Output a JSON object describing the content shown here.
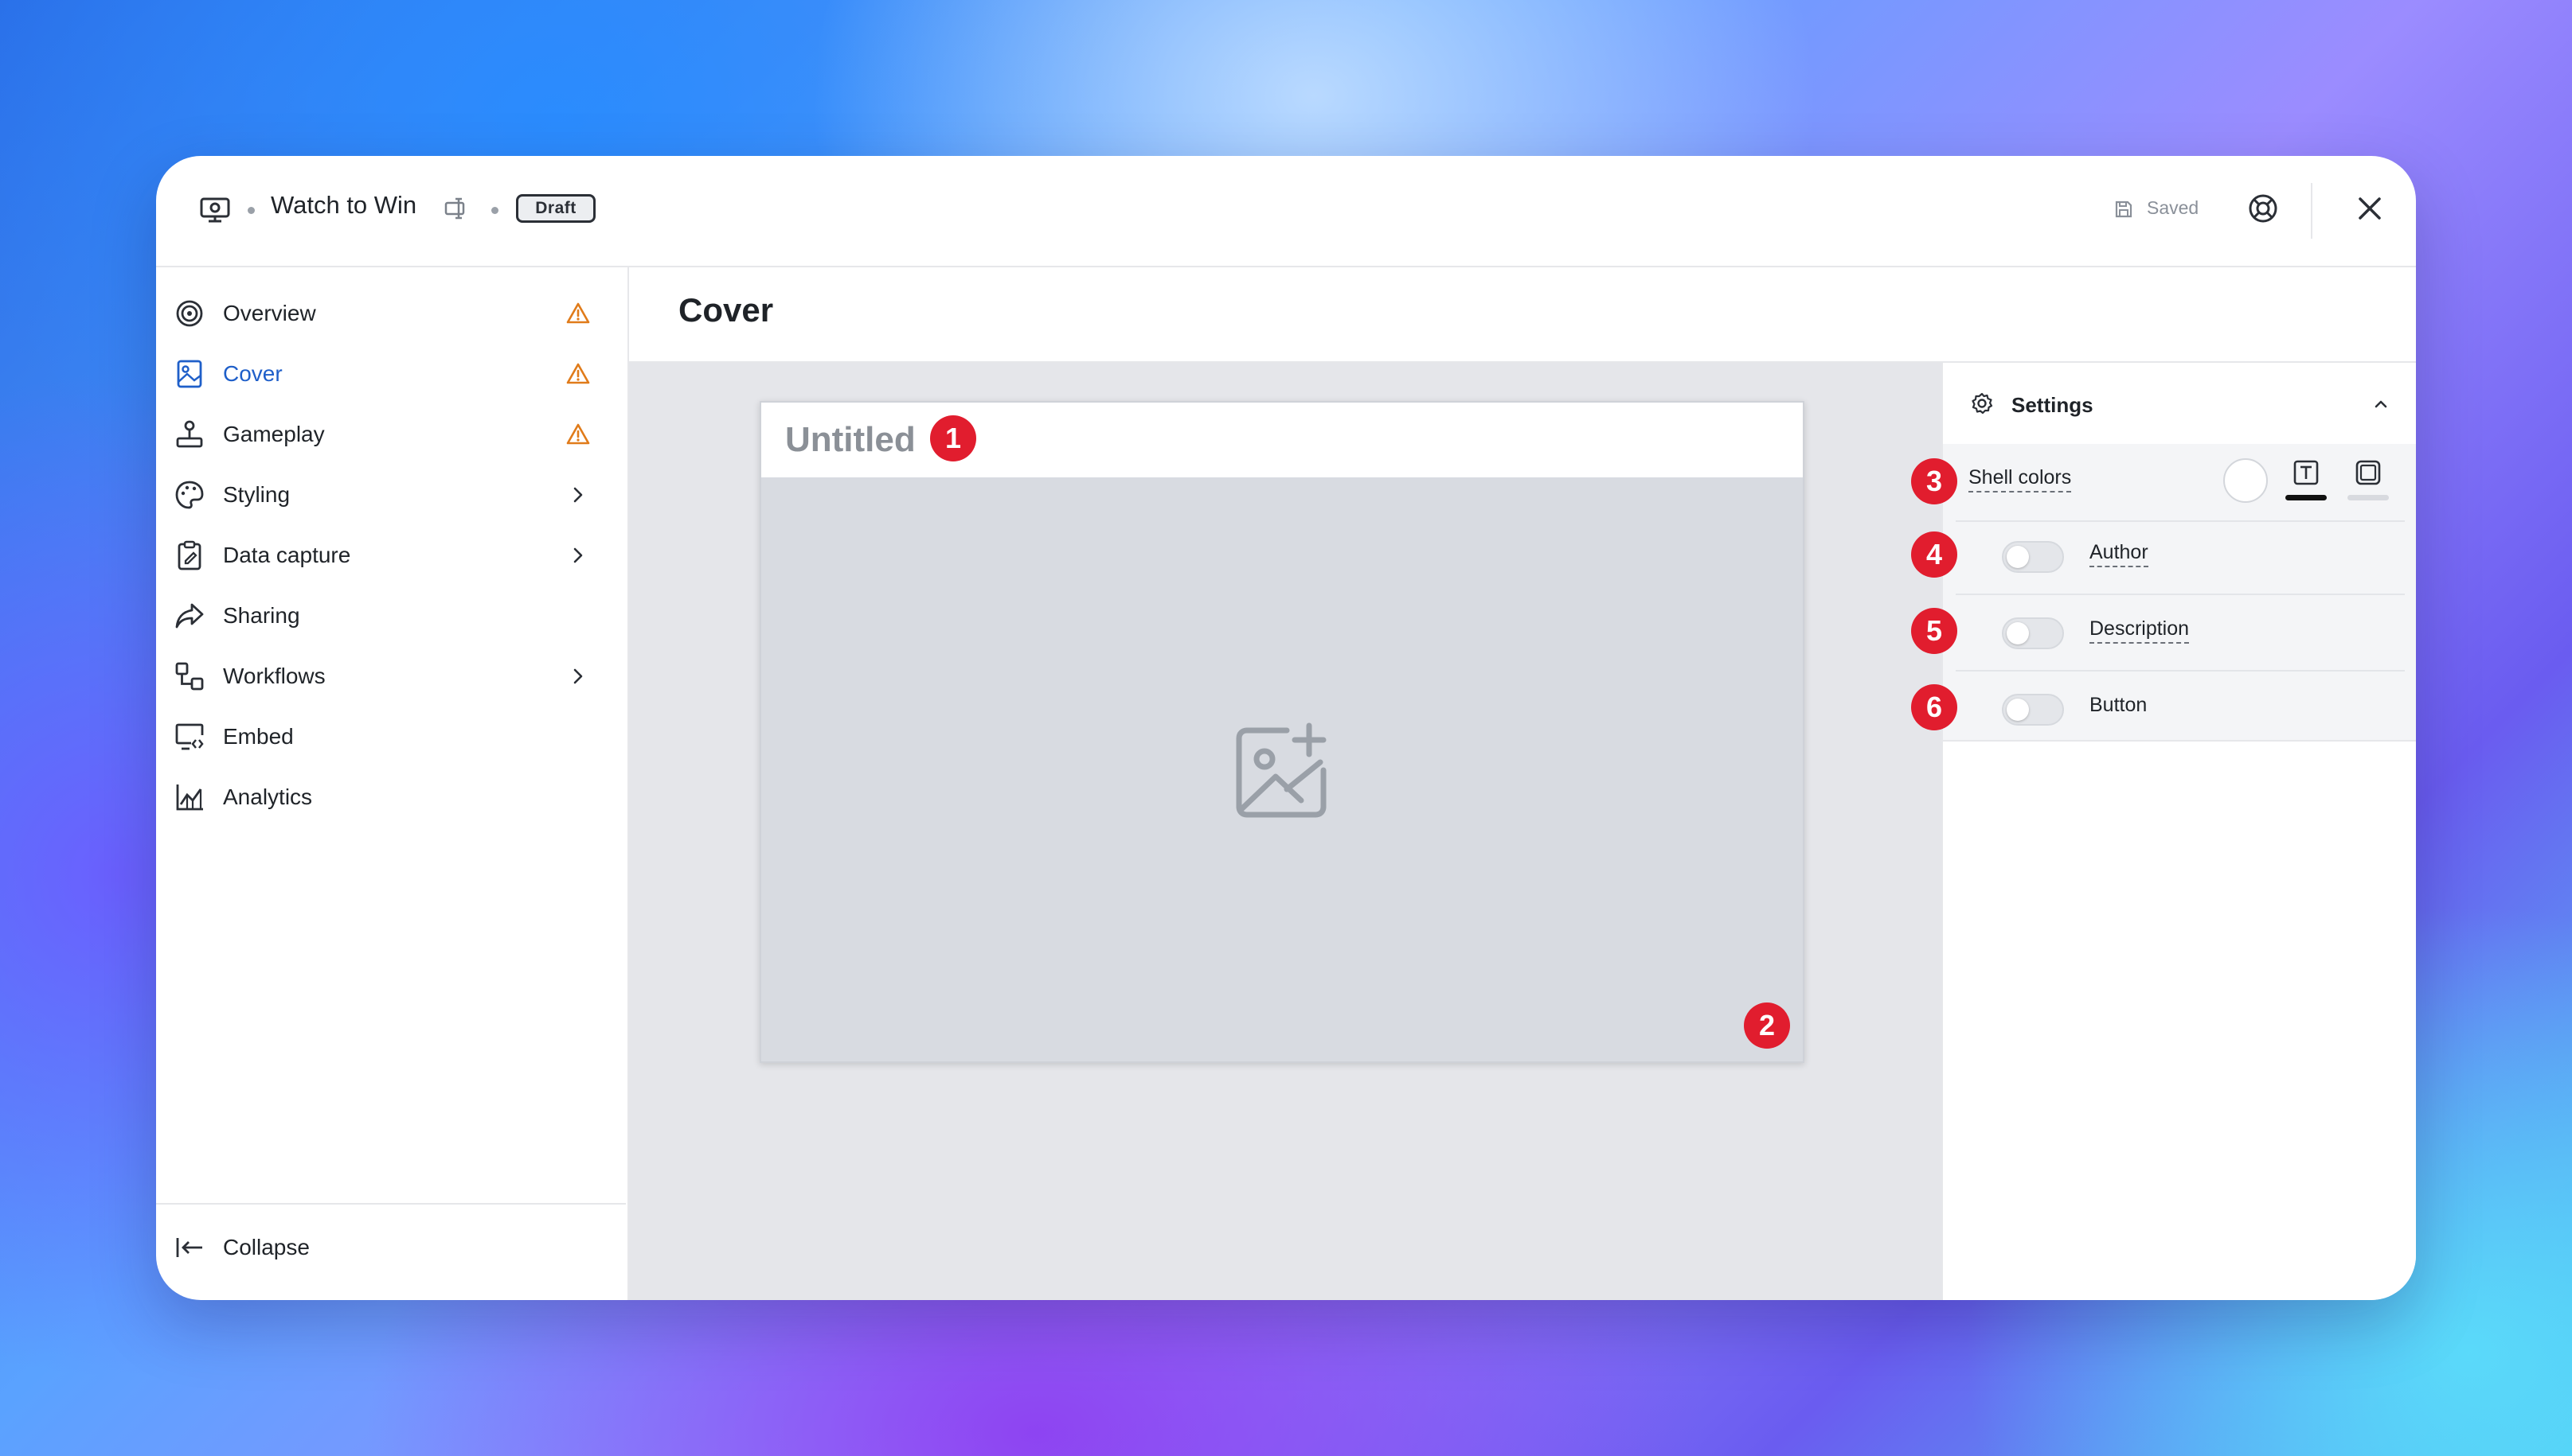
{
  "header": {
    "title": "Watch to Win",
    "status_badge": "Draft",
    "saved_label": "Saved"
  },
  "sidebar": {
    "items": [
      {
        "label": "Overview",
        "icon": "target-icon",
        "trail": "warning"
      },
      {
        "label": "Cover",
        "icon": "image-portrait-icon",
        "trail": "warning",
        "active": true
      },
      {
        "label": "Gameplay",
        "icon": "joystick-icon",
        "trail": "warning"
      },
      {
        "label": "Styling",
        "icon": "palette-icon",
        "trail": "chevron"
      },
      {
        "label": "Data capture",
        "icon": "clipboard-icon",
        "trail": "chevron"
      },
      {
        "label": "Sharing",
        "icon": "share-arrow-icon",
        "trail": ""
      },
      {
        "label": "Workflows",
        "icon": "workflow-icon",
        "trail": "chevron"
      },
      {
        "label": "Embed",
        "icon": "embed-monitor-icon",
        "trail": ""
      },
      {
        "label": "Analytics",
        "icon": "chart-icon",
        "trail": ""
      }
    ],
    "collapse_label": "Collapse"
  },
  "main": {
    "title": "Cover",
    "card_title": "Untitled"
  },
  "settings": {
    "title": "Settings",
    "shell_colors_label": "Shell colors",
    "author_label": "Author",
    "description_label": "Description",
    "button_label": "Button",
    "author_on": false,
    "description_on": false,
    "button_on": false
  },
  "annotations": {
    "b1": "1",
    "b2": "2",
    "b3": "3",
    "b4": "4",
    "b5": "5",
    "b6": "6"
  },
  "colors": {
    "accent": "#1f5fc9",
    "warning": "#e07b1a",
    "badge": "#e11d2e"
  }
}
